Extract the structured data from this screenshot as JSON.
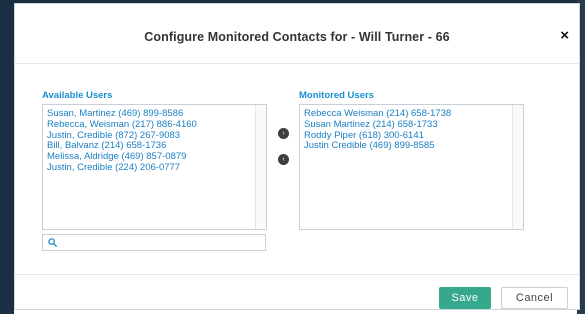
{
  "dialog": {
    "title": "Configure Monitored Contacts for - Will Turner - 66",
    "close_label": "×"
  },
  "available": {
    "label": "Available Users",
    "items": [
      "Susan, Martinez (469) 899-8586",
      "Rebecca, Weisman (217) 886-4160",
      "Justin, Credible (872) 267-9083",
      "Bill, Balvanz (214) 658-1736",
      "Melissa, Aldridge (469) 857-0879",
      "Justin, Credible (224) 206-0777"
    ]
  },
  "monitored": {
    "label": "Monitored Users",
    "items": [
      "Rebecca Weisman (214) 658-1738",
      "Susan Martinez (214) 658-1733",
      "Roddy Piper (618) 300-6141",
      "Justin Credible (469) 899-8585"
    ]
  },
  "controls": {
    "move_right_glyph": "›",
    "move_left_glyph": "‹"
  },
  "search": {
    "value": "",
    "placeholder": ""
  },
  "footer": {
    "save_label": "Save",
    "cancel_label": "Cancel"
  },
  "colors": {
    "accent_link": "#1a7fc4",
    "save_button": "#36a88b",
    "backdrop": "#1b2f44"
  }
}
